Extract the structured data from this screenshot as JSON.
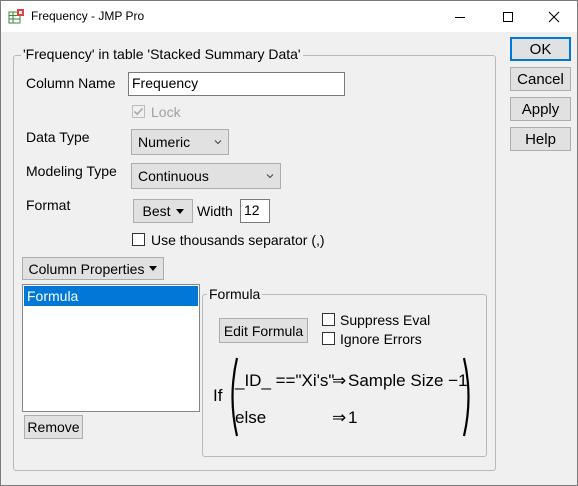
{
  "window": {
    "title": "Frequency - JMP Pro",
    "minimize_icon": "minimize-icon",
    "maximize_icon": "maximize-icon",
    "close_icon": "close-icon"
  },
  "group_title": "'Frequency' in table 'Stacked Summary Data'",
  "column_name": {
    "label": "Column Name",
    "value": "Frequency"
  },
  "lock": {
    "label": "Lock",
    "checked": true,
    "disabled": true
  },
  "data_type": {
    "label": "Data Type",
    "value": "Numeric"
  },
  "modeling_type": {
    "label": "Modeling Type",
    "value": "Continuous"
  },
  "format": {
    "label": "Format",
    "button_label": "Best",
    "width_label": "Width",
    "width_value": "12",
    "thousands_label": "Use thousands separator (,)",
    "thousands_checked": false
  },
  "column_properties": {
    "button_label": "Column Properties",
    "items": [
      "Formula"
    ],
    "selected_index": 0,
    "remove_label": "Remove"
  },
  "formula_panel": {
    "title": "Formula",
    "edit_label": "Edit Formula",
    "suppress_eval_label": "Suppress Eval",
    "suppress_eval_checked": false,
    "ignore_errors_label": "Ignore Errors",
    "ignore_errors_checked": false,
    "expression": {
      "keyword": "If",
      "condition": "_ID_ ==\"Xi's\"",
      "arrow": "⇒",
      "then_value": "Sample Size −1",
      "else_label": "else",
      "else_value": "1"
    }
  },
  "buttons": {
    "ok": "OK",
    "cancel": "Cancel",
    "apply": "Apply",
    "help": "Help"
  },
  "colors": {
    "selection": "#0078d7",
    "accent_border": "#0078d7",
    "app_icon": "#3a8a3a"
  }
}
